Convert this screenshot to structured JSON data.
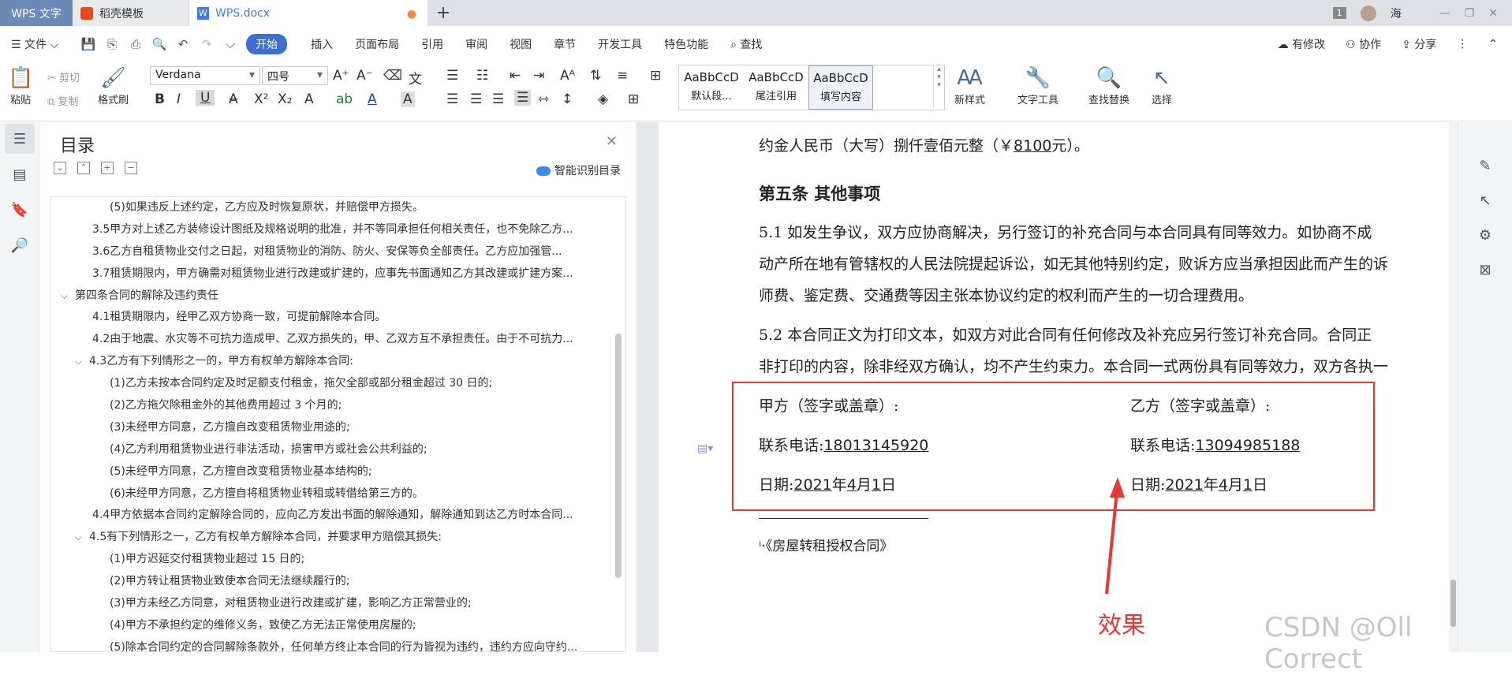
{
  "titlebar": {
    "app_tab": "WPS 文字",
    "tab1": "稻壳模板",
    "tab2": "WPS.docx",
    "badge": "1",
    "user": "海"
  },
  "menubar": {
    "file": "文件",
    "start": "开始",
    "items": [
      "插入",
      "页面布局",
      "引用",
      "审阅",
      "视图",
      "章节",
      "开发工具",
      "特色功能"
    ],
    "search": "查找",
    "right": [
      "有修改",
      "协作",
      "分享"
    ]
  },
  "ribbon": {
    "paste": "粘贴",
    "cut": "剪切",
    "copy": "复制",
    "format_painter": "格式刷",
    "font": "Verdana",
    "size": "四号",
    "styles": [
      {
        "sample": "AaBbCcD",
        "label": "默认段..."
      },
      {
        "sample": "AaBbCcD",
        "label": "尾注引用"
      },
      {
        "sample": "AaBbCcD",
        "label": "填写内容"
      }
    ],
    "new_style": "新样式",
    "text_tools": "文字工具",
    "find_replace": "查找替换",
    "select": "选择"
  },
  "toc": {
    "title": "目录",
    "smart": "智能识别目录",
    "items": [
      {
        "level": 3,
        "text": "(5)如果违反上述约定，乙方应及时恢复原状，并赔偿甲方损失。"
      },
      {
        "level": 2,
        "text": "3.5甲方对上述乙方装修设计图纸及规格说明的批准，并不等同承担任何相关责任，也不免除乙方..."
      },
      {
        "level": 2,
        "text": "3.6乙方自租赁物业交付之日起，对租赁物业的消防、防火、安保等负全部责任。乙方应加强管..."
      },
      {
        "level": 2,
        "text": "3.7租赁期限内，甲方确需对租赁物业进行改建或扩建的，应事先书面通知乙方其改建或扩建方案..."
      },
      {
        "level": 1,
        "chev": true,
        "text": "第四条合同的解除及违约责任"
      },
      {
        "level": 2,
        "text": "4.1租赁期限内，经甲乙双方协商一致，可提前解除本合同。"
      },
      {
        "level": 2,
        "text": "4.2由于地震、水灾等不可抗力造成甲、乙双方损失的，甲、乙双方互不承担责任。由于不可抗力..."
      },
      {
        "level": 2,
        "chev": true,
        "text": "4.3乙方有下列情形之一的，甲方有权单方解除本合同:"
      },
      {
        "level": 3,
        "text": "(1)乙方未按本合同约定及时足额支付租金，拖欠全部或部分租金超过 30 日的;"
      },
      {
        "level": 3,
        "text": "(2)乙方拖欠除租金外的其他费用超过 3 个月的;"
      },
      {
        "level": 3,
        "text": "(3)未经甲方同意，乙方擅自改变租赁物业用途的;"
      },
      {
        "level": 3,
        "text": "(4)乙方利用租赁物业进行非法活动，损害甲方或社会公共利益的;"
      },
      {
        "level": 3,
        "text": "(5)未经甲方同意，乙方擅自改变租赁物业基本结构的;"
      },
      {
        "level": 3,
        "text": "(6)未经甲方同意，乙方擅自将租赁物业转租或转借给第三方的。"
      },
      {
        "level": 2,
        "text": "4.4甲方依据本合同约定解除合同的，应向乙方发出书面的解除通知，解除通知到达乙方时本合同..."
      },
      {
        "level": 2,
        "chev": true,
        "text": "4.5有下列情形之一，乙方有权单方解除本合同，并要求甲方赔偿其损失:"
      },
      {
        "level": 3,
        "text": "(1)甲方迟延交付租赁物业超过 15 日的;"
      },
      {
        "level": 3,
        "text": "(2)甲方转让租赁物业致使本合同无法继续履行的;"
      },
      {
        "level": 3,
        "text": "(3)甲方未经乙方同意，对租赁物业进行改建或扩建，影响乙方正常营业的;"
      },
      {
        "level": 3,
        "text": "(4)甲方不承担约定的维修义务，致使乙方无法正常使用房屋的;"
      },
      {
        "level": 3,
        "text": "(5)除本合同约定的合同解除条款外，任何单方终止本合同的行为皆视为违约，违约方应向守约..."
      }
    ]
  },
  "doc": {
    "line_top_a": "约金人民币（大写）捌仟壹佰元整（￥",
    "line_top_amt": "8100",
    "line_top_b": "元）。",
    "section5": "第五条 其他事项",
    "p51_1": "5.1  如发生争议，双方应协商解决，另行签订的补充合同与本合同具有同等效力。如协商不成",
    "p51_2": "动产所在地有管辖权的人民法院提起诉讼，如无其他特别约定，败诉方应当承担因此而产生的诉",
    "p51_3": "师费、鉴定费、交通费等因主张本协议约定的权利而产生的一切合理费用。",
    "p52_1": "5.2  本合同正文为打印文本，如双方对此合同有任何修改及补充应另行签订补充合同。合同正",
    "p52_2": "非打印的内容，除非经双方确认，均不产生约束力。本合同一式两份具有同等效力，双方各执一",
    "party_a": "甲方（签字或盖章）:",
    "party_b": "乙方（签字或盖章）:",
    "phone_label": "联系电话:",
    "phone_a": "18013145920",
    "phone_b": "13094985188",
    "date_label": "日期:",
    "year": "2021",
    "year_u": "年",
    "month": "4",
    "month_u": "月",
    "day": "1",
    "day_u": "日",
    "footnote": "《房屋转租授权合同》",
    "effect": "效果",
    "watermark": "CSDN @Oll Correct"
  }
}
